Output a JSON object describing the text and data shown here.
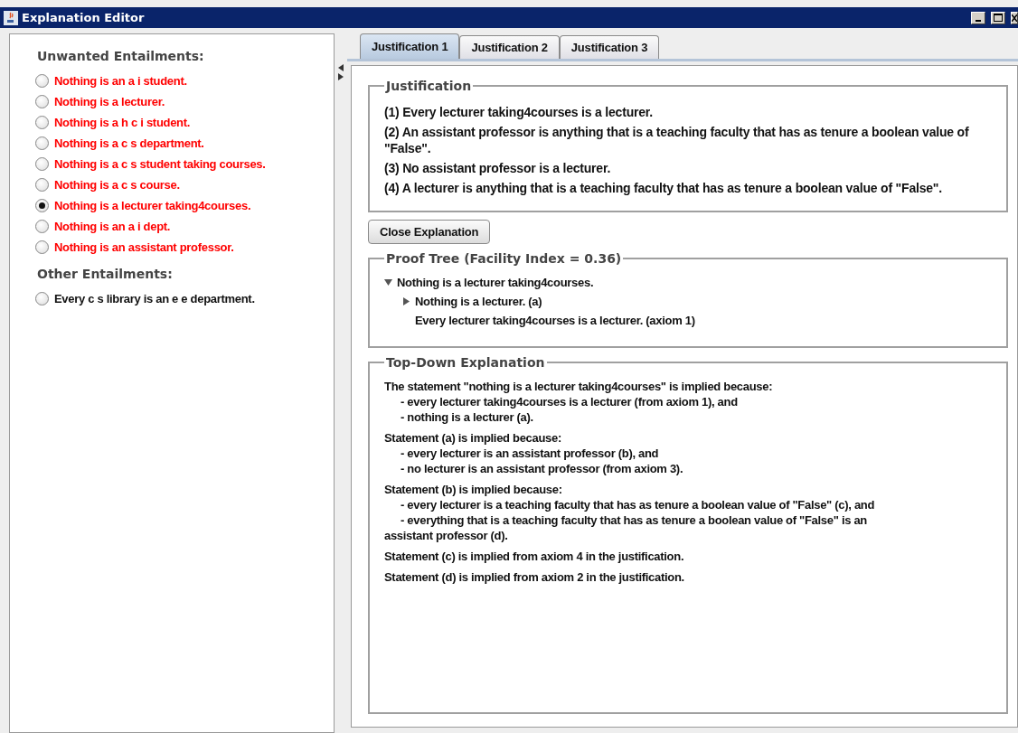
{
  "window": {
    "title": "Explanation Editor"
  },
  "sections": [
    {
      "kind": "unwanted",
      "title": "Unwanted Entailments:",
      "items": [
        {
          "label": "Nothing is an a i student.",
          "selected": false
        },
        {
          "label": "Nothing is a lecturer.",
          "selected": false
        },
        {
          "label": "Nothing is a h c i student.",
          "selected": false
        },
        {
          "label": "Nothing is a c s department.",
          "selected": false
        },
        {
          "label": "Nothing is a c s student taking courses.",
          "selected": false
        },
        {
          "label": "Nothing is a c s course.",
          "selected": false
        },
        {
          "label": "Nothing is a lecturer taking4courses.",
          "selected": true
        },
        {
          "label": "Nothing is an a i dept.",
          "selected": false
        },
        {
          "label": "Nothing is an assistant professor.",
          "selected": false
        }
      ]
    },
    {
      "kind": "other",
      "title": "Other Entailments:",
      "items": [
        {
          "label": "Every c s library is an e e department.",
          "selected": false
        }
      ]
    }
  ],
  "tabs": [
    {
      "label": "Justification 1",
      "selected": true
    },
    {
      "label": "Justification 2",
      "selected": false
    },
    {
      "label": "Justification 3",
      "selected": false
    }
  ],
  "justification": {
    "title": "Justification",
    "axioms": [
      "(1) Every lecturer taking4courses is a lecturer.",
      "(2) An assistant professor is anything that is a teaching faculty that has as tenure a boolean value of \"False\".",
      "(3) No assistant professor is a lecturer.",
      "(4) A lecturer is anything that is a teaching faculty that has as tenure a boolean value of \"False\"."
    ]
  },
  "close_button": "Close Explanation",
  "proof_tree": {
    "title": "Proof Tree (Facility Index = 0.36)",
    "nodes": [
      {
        "label": "Nothing is a lecturer taking4courses.",
        "expanded": true,
        "children": [
          {
            "label": "Nothing is a lecturer. (a)",
            "expanded": false
          },
          {
            "label": "Every lecturer taking4courses is a lecturer. (axiom 1)"
          }
        ]
      }
    ]
  },
  "top_down": {
    "title": "Top-Down Explanation",
    "paragraphs": [
      {
        "lines": [
          {
            "kind": "main",
            "text": "The statement \"nothing is a lecturer taking4courses\" is implied because:"
          },
          {
            "kind": "sub",
            "text": "- every lecturer taking4courses is a lecturer (from axiom 1), and"
          },
          {
            "kind": "sub",
            "text": "- nothing is a lecturer (a)."
          }
        ]
      },
      {
        "lines": [
          {
            "kind": "main",
            "text": "Statement (a) is implied because:"
          },
          {
            "kind": "sub",
            "text": "- every lecturer is an assistant professor (b), and"
          },
          {
            "kind": "sub",
            "text": "- no lecturer is an assistant professor (from axiom 3)."
          }
        ]
      },
      {
        "lines": [
          {
            "kind": "main",
            "text": "Statement (b) is implied because:"
          },
          {
            "kind": "sub",
            "text": "- every lecturer is a teaching faculty that has as tenure a boolean value of \"False\" (c), and"
          },
          {
            "kind": "sub",
            "text": "- everything that is a teaching faculty that has as tenure a boolean value of \"False\" is an"
          },
          {
            "kind": "main",
            "text": "assistant professor (d)."
          }
        ]
      },
      {
        "lines": [
          {
            "kind": "main",
            "text": "Statement (c) is implied from axiom 4 in the justification."
          }
        ]
      },
      {
        "lines": [
          {
            "kind": "main",
            "text": "Statement (d) is implied from axiom 2 in the justification."
          }
        ]
      }
    ]
  }
}
